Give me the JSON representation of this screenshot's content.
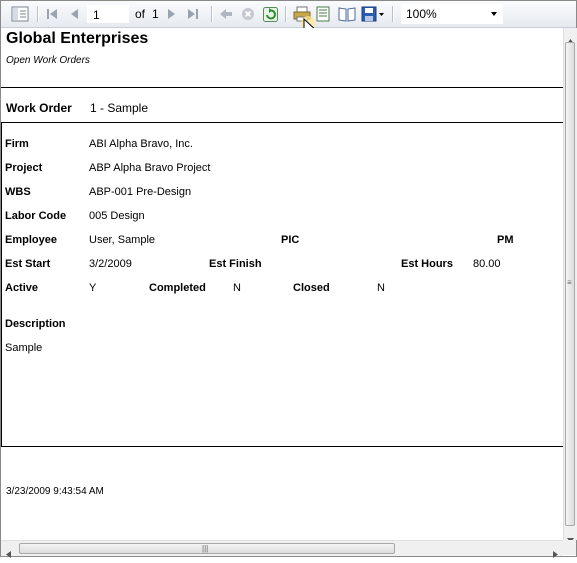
{
  "toolbar": {
    "current_page": "1",
    "of_label": "of",
    "total_pages": "1",
    "zoom_value": "100%"
  },
  "report": {
    "company": "Global Enterprises",
    "subtitle": "Open Work Orders",
    "work_order_label": "Work Order",
    "work_order_value": "1 - Sample",
    "fields": {
      "firm_label": "Firm",
      "firm_value": "ABI Alpha Bravo, Inc.",
      "project_label": "Project",
      "project_value": "ABP Alpha Bravo Project",
      "wbs_label": "WBS",
      "wbs_value": "ABP-001 Pre-Design",
      "labor_code_label": "Labor Code",
      "labor_code_value": "005 Design",
      "employee_label": "Employee",
      "employee_value": "User, Sample",
      "pic_label": "PIC",
      "pm_label": "PM",
      "est_start_label": "Est Start",
      "est_start_value": "3/2/2009",
      "est_finish_label": "Est Finish",
      "est_hours_label": "Est Hours",
      "est_hours_value": "80.00",
      "active_label": "Active",
      "active_value": "Y",
      "completed_label": "Completed",
      "completed_value": "N",
      "closed_label": "Closed",
      "closed_value": "N",
      "description_label": "Description",
      "description_value": "Sample"
    },
    "timestamp": "3/23/2009 9:43:54 AM"
  },
  "icons": {
    "doc_map": "document-map-icon",
    "first": "first-page-icon",
    "prev": "previous-page-icon",
    "next": "next-page-icon",
    "last": "last-page-icon",
    "back": "back-icon",
    "stop": "stop-icon",
    "refresh": "refresh-icon",
    "print": "print-icon",
    "print_layout": "print-layout-icon",
    "page_setup": "page-setup-icon",
    "export": "export-save-icon"
  },
  "colors": {
    "toolbar_bg": "#e6eaf0",
    "refresh_green": "#2e8b2e",
    "export_blue": "#2a5db0"
  }
}
